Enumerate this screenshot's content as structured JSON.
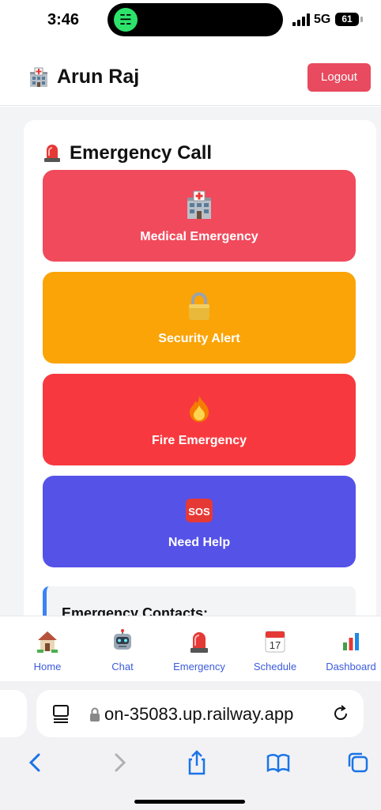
{
  "status_bar": {
    "time": "3:46",
    "network": "5G",
    "battery": "61"
  },
  "header": {
    "user_name": "Arun Raj",
    "logout_label": "Logout"
  },
  "emergency": {
    "title": "Emergency Call",
    "buttons": [
      {
        "label": "Medical Emergency",
        "icon": "hospital-icon",
        "color": "#f14a5c"
      },
      {
        "label": "Security Alert",
        "icon": "lock-icon",
        "color": "#fba407"
      },
      {
        "label": "Fire Emergency",
        "icon": "fire-icon",
        "color": "#f7393f"
      },
      {
        "label": "Need Help",
        "icon": "sos-icon",
        "color": "#5552e8"
      }
    ],
    "contacts_title": "Emergency Contacts:"
  },
  "nav": {
    "items": [
      {
        "label": "Home",
        "icon": "house-icon"
      },
      {
        "label": "Chat",
        "icon": "robot-icon"
      },
      {
        "label": "Emergency",
        "icon": "siren-icon"
      },
      {
        "label": "Schedule",
        "icon": "calendar-icon",
        "calendar_day": "17"
      },
      {
        "label": "Dashboard",
        "icon": "bar-chart-icon"
      }
    ]
  },
  "browser": {
    "url": "on-35083.up.railway.app"
  },
  "colors": {
    "accent": "#3b5bdb",
    "logout": "#e84a5f"
  }
}
